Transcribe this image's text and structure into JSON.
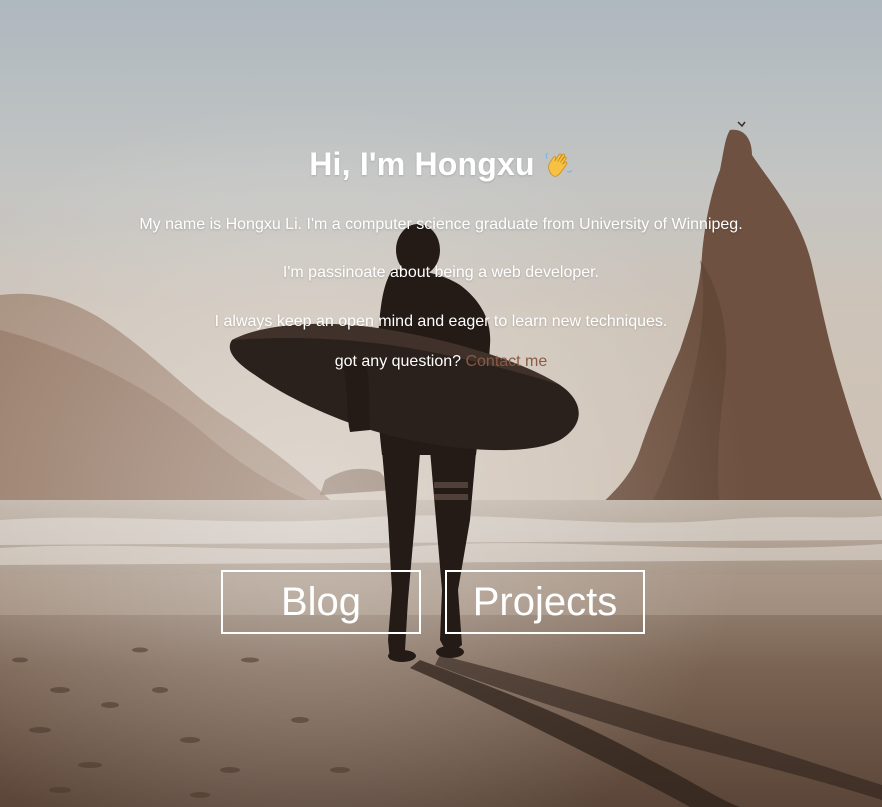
{
  "hero": {
    "title": "Hi, I'm Hongxu",
    "title_icon": "waving-hand-icon",
    "paragraphs": [
      "My name is Hongxu Li. I'm a computer science graduate from University of Winnipeg.",
      "I'm passinoate about being a web developer.",
      "I always keep an open mind and eager to learn new techniques."
    ],
    "question_text": "got any question? ",
    "contact_link": "Contact me"
  },
  "buttons": {
    "blog": "Blog",
    "projects": "Projects"
  },
  "colors": {
    "text": "#ffffff",
    "link": "#8a5a44",
    "button_border": "#ffffff"
  }
}
